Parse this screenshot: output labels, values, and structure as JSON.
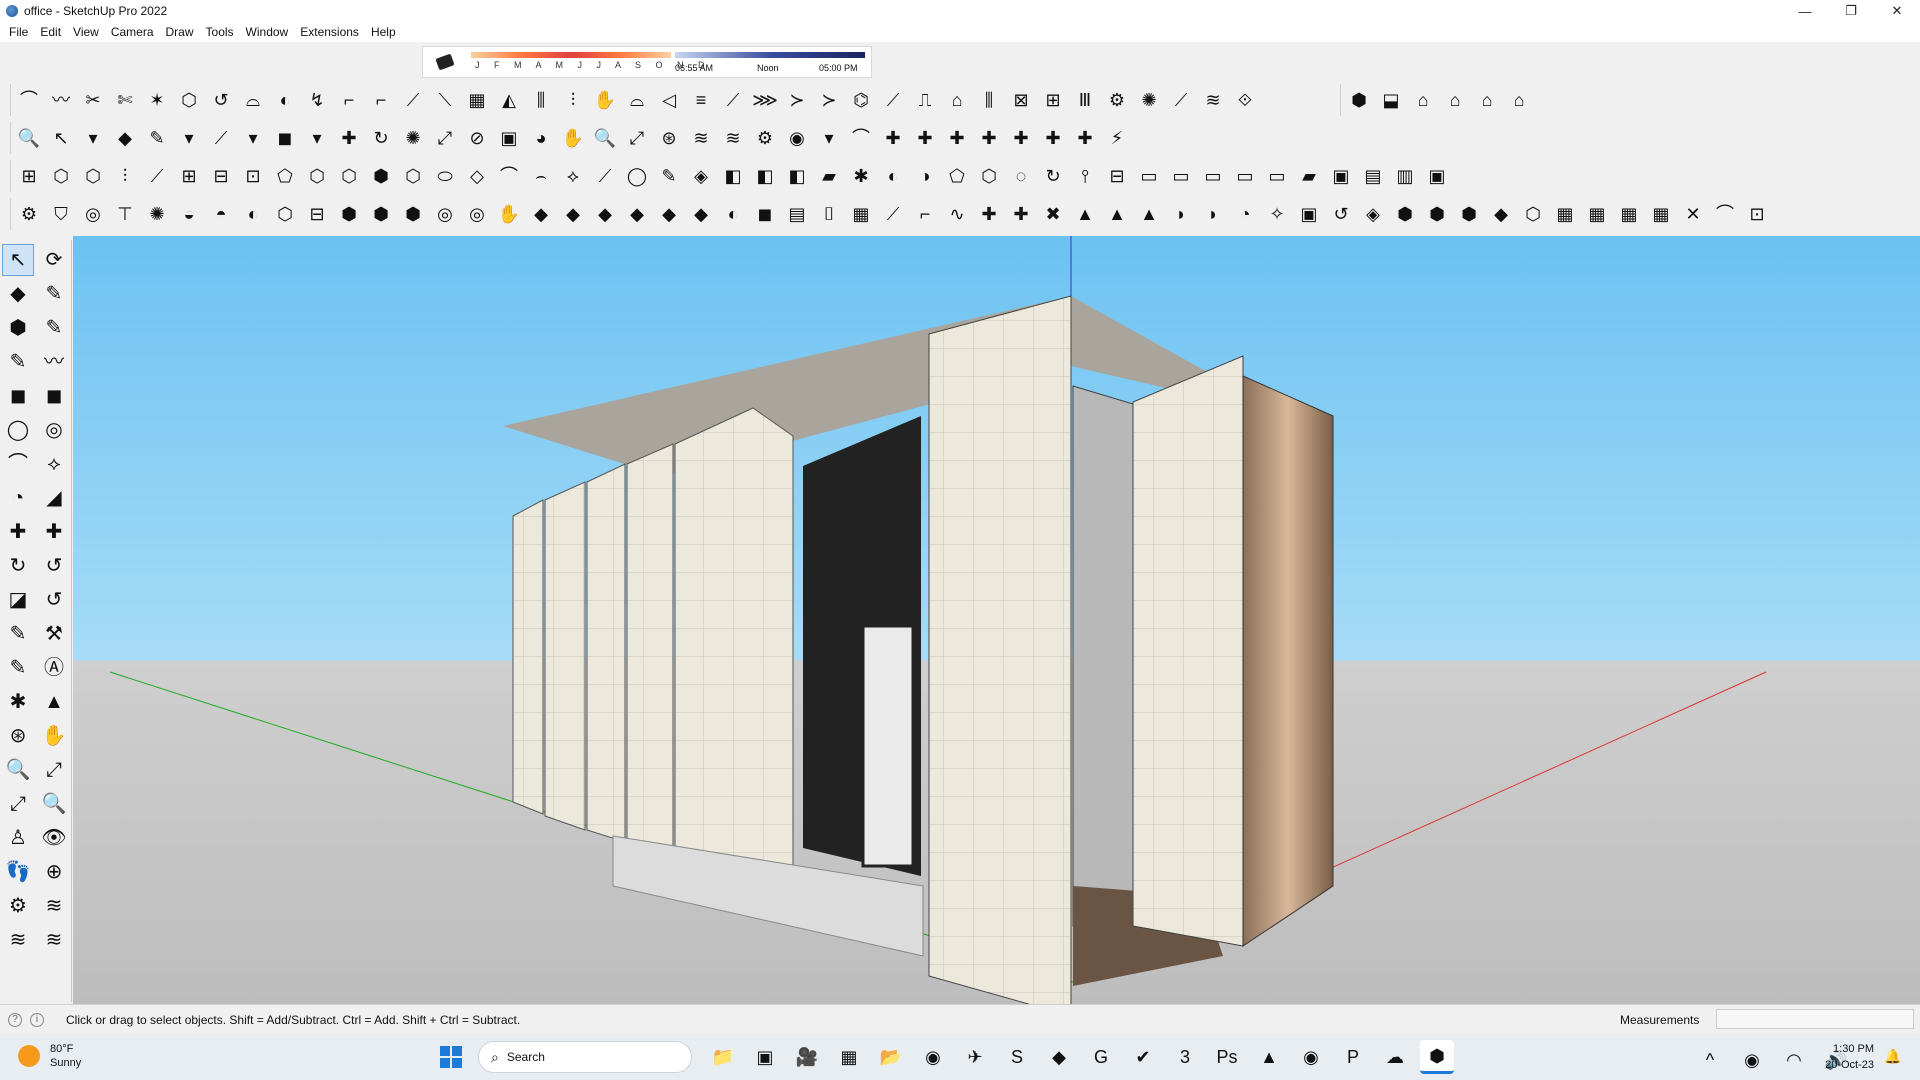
{
  "window": {
    "title": "office - SketchUp Pro 2022",
    "controls": [
      "—",
      "❐",
      "✕"
    ]
  },
  "menu": [
    "File",
    "Edit",
    "View",
    "Camera",
    "Draw",
    "Tools",
    "Window",
    "Extensions",
    "Help"
  ],
  "shadow_settings": {
    "months": "J F M A M J J A S O N D",
    "time_start": "06:55 AM",
    "time_mid": "Noon",
    "time_end": "05:00 PM"
  },
  "toolbars": {
    "row1": [
      "⌒",
      "〰",
      "✂",
      "✄",
      "✶",
      "⬡",
      "↺",
      "⌓",
      "◐",
      "↯",
      "⌐",
      "⌐",
      "⟋",
      "⟍",
      "▦",
      "◭",
      "⫼",
      "⫶",
      "✋",
      "⌓",
      "◁",
      "≡",
      "⟋",
      "⋙",
      "≻",
      "≻",
      "⌬",
      "⟋",
      "⎍",
      "⌂",
      "⫼",
      "⊠",
      "⊞",
      "Ⅲ",
      "⚙",
      "✺",
      "⟋",
      "≋",
      "⟐"
    ],
    "row1_group2": [
      "⬢",
      "⬓",
      "⌂",
      "⌂",
      "⌂",
      "⌂"
    ],
    "row2": [
      "🔍",
      "↖",
      "▾",
      "◆",
      "✎",
      "▾",
      "⟋",
      "▾",
      "◼",
      "▾",
      "✚",
      "↻",
      "✺",
      "⤢",
      "⊘",
      "▣",
      "◕",
      "✋",
      "🔍",
      "⤢",
      "⊛",
      "≋",
      "≋",
      "⚙",
      "◉",
      "▾",
      "⌒",
      "✚",
      "✚",
      "✚",
      "✚",
      "✚",
      "✚",
      "✚",
      "⚡"
    ],
    "row3": [
      "⊞",
      "⬡",
      "⬡",
      "⫶",
      "⟋",
      "⊞",
      "⊟",
      "⊡",
      "⬠",
      "⬡",
      "⬡",
      "⬢",
      "⬡",
      "⬭",
      "◇",
      "⌒",
      "⌢",
      "⟡",
      "⟋",
      "◯",
      "✎",
      "◈",
      "◧",
      "◧",
      "◧",
      "▰",
      "✱",
      "◐",
      "◑",
      "⬠",
      "⬡",
      "◌",
      "↻",
      "⫯",
      "⊟",
      "▭",
      "▭",
      "▭",
      "▭",
      "▭",
      "▰",
      "▣",
      "▤",
      "▥",
      "▣"
    ],
    "row4": [
      "⚙",
      "⛉",
      "◎",
      "⊤",
      "✺",
      "◒",
      "◓",
      "◐",
      "⬡",
      "⊟",
      "⬢",
      "⬢",
      "⬢",
      "◎",
      "◎",
      "✋",
      "◆",
      "◆",
      "◆",
      "◆",
      "◆",
      "◆",
      "◐",
      "◼",
      "▤",
      "⌷",
      "▦",
      "⟋",
      "⌐",
      "∿",
      "✚",
      "✚",
      "✖",
      "▲",
      "▲",
      "▲",
      "◗",
      "◗",
      "◔",
      "✧",
      "▣",
      "↺",
      "◈",
      "⬢",
      "⬢",
      "⬢",
      "◆",
      "⬡",
      "▦",
      "▦",
      "▦",
      "▦",
      "✕",
      "⌒",
      "⊡"
    ],
    "left": [
      "↖",
      "⟳",
      "◆",
      "✎",
      "⬢",
      "✎",
      "✎",
      "〰",
      "◼",
      "◼",
      "◯",
      "◎",
      "⌒",
      "⟡",
      "◔",
      "◢",
      "✚",
      "✚",
      "↻",
      "↺",
      "◪",
      "↺",
      "✎",
      "⚒",
      "✎",
      "Ⓐ",
      "✱",
      "▲",
      "⊛",
      "✋",
      "🔍",
      "⤢",
      "⤢",
      "🔍",
      "♙",
      "👁",
      "👣",
      "⊕",
      "⚙",
      "≋",
      "≋",
      "≋"
    ]
  },
  "status": {
    "hint": "Click or drag to select objects. Shift = Add/Subtract. Ctrl = Add. Shift + Ctrl = Subtract.",
    "measurements_label": "Measurements",
    "measurements_value": ""
  },
  "taskbar": {
    "temperature": "80°F",
    "condition": "Sunny",
    "search_placeholder": "Search",
    "apps": [
      "📁",
      "▣",
      "🎥",
      "▦",
      "📂",
      "◉",
      "✈",
      "S",
      "◆",
      "G",
      "✔",
      "3",
      "Ps",
      "▲",
      "◉",
      "P",
      "☁",
      "⬢"
    ],
    "tray": [
      "^",
      "◉",
      "◠",
      "🔊"
    ],
    "time": "1:30 PM",
    "date": "20-Oct-23"
  },
  "colors": {
    "sky": "#6cc2f2",
    "ground": "#cfcfcf",
    "x_axis": "#d33",
    "y_axis": "#2a2",
    "z_axis": "#33c",
    "wall": "#e8e4d8"
  }
}
